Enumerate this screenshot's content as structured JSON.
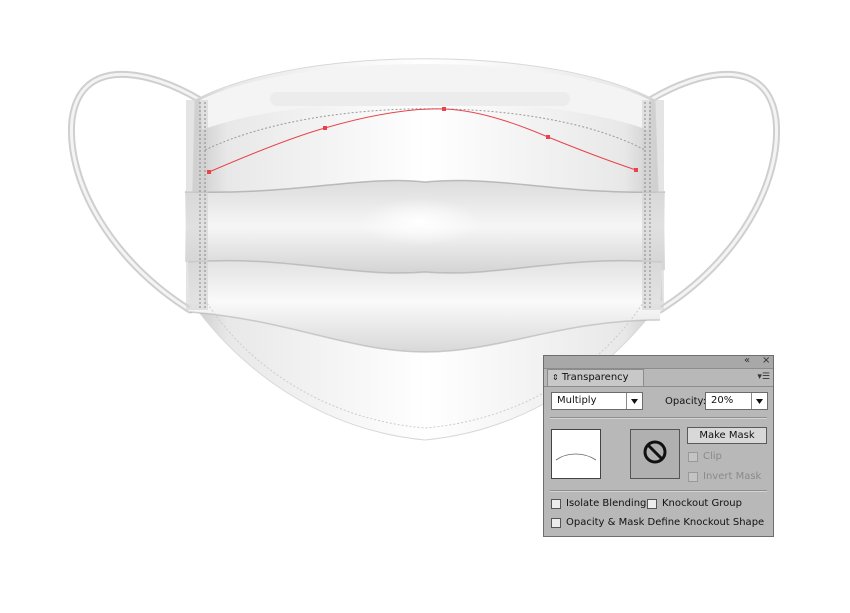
{
  "panel": {
    "collapse_icon": "double-chevron-left-icon",
    "close_icon": "close-icon",
    "tab_label": "Transparency",
    "tab_icon": "up-down-arrows-icon",
    "menu_icon": "panel-menu-icon",
    "blend_mode": "Multiply",
    "opacity_label": "Opacity:",
    "opacity_value": "20%",
    "make_mask_label": "Make Mask",
    "clip_label": "Clip",
    "invert_mask_label": "Invert Mask",
    "isolate_blending_label": "Isolate Blending",
    "knockout_group_label": "Knockout Group",
    "opacity_mask_label": "Opacity & Mask Define Knockout Shape",
    "no_mask_icon": "no-symbol-icon"
  },
  "colors": {
    "path_color": "#e8434b",
    "panel_bg": "#b8b8b8"
  }
}
